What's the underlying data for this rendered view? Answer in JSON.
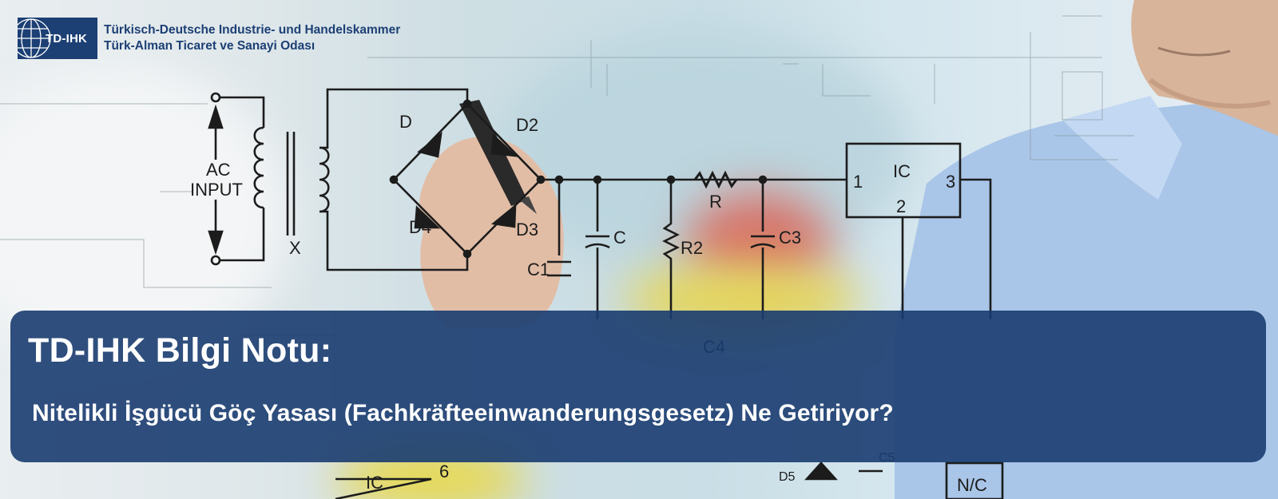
{
  "logo": {
    "abbreviation": "TD-IHK",
    "line1": "Türkisch-Deutsche Industrie- und Handelskammer",
    "line2": "Türk-Alman Ticaret ve Sanayi Odası"
  },
  "schematic": {
    "labels": [
      "AC",
      "INPUT",
      "X",
      "D",
      "D2",
      "D4",
      "D3",
      "C1",
      "C",
      "R2",
      "R",
      "C3",
      "IC",
      "1",
      "2",
      "3",
      "C4",
      "IC",
      "6",
      "N/C",
      "D5",
      "C5"
    ]
  },
  "banner": {
    "title": "TD-IHK Bilgi Notu:",
    "subtitle": "Nitelikli İşgücü Göç Yasası (Fachkräfteeinwanderungsgesetz) Ne Getiriyor?"
  },
  "colors": {
    "panel": "#1a3c70",
    "brand_blue": "#1c3f74",
    "text_on_panel": "#ffffff"
  }
}
